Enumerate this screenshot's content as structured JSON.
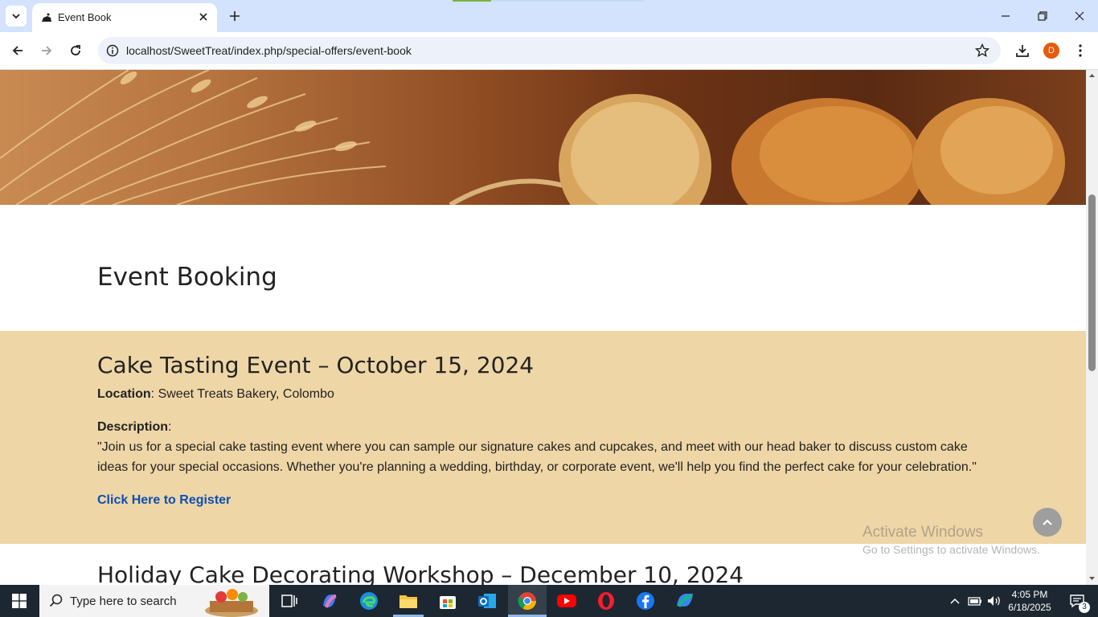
{
  "browser": {
    "tab_title": "Event Book",
    "url": "localhost/SweetTreat/index.php/special-offers/event-book",
    "profile_initial": "D"
  },
  "page": {
    "heading": "Event Booking",
    "event1": {
      "title": "Cake Tasting Event – October 15, 2024",
      "location_label": "Location",
      "location_value": ": Sweet Treats Bakery, Colombo",
      "description_label": "Description",
      "description_colon": ":",
      "description": "\"Join us for a special cake tasting event where you can sample our signature cakes and cupcakes, and meet with our head baker to discuss custom cake ideas for your special occasions. Whether you're planning a wedding, birthday, or corporate event, we'll help you find the perfect cake for your celebration.\"",
      "register_link": "Click Here to Register"
    },
    "event2": {
      "title": "Holiday Cake Decorating Workshop – December 10, 2024"
    }
  },
  "watermark": {
    "line1": "Activate Windows",
    "line2": "Go to Settings to activate Windows."
  },
  "taskbar": {
    "search_placeholder": "Type here to search",
    "time": "4:05 PM",
    "date": "6/18/2025",
    "notification_count": "3"
  },
  "colors": {
    "event_bg": "#efd6a6",
    "link": "#0b4fb3",
    "tabbar": "#d3e3fd"
  }
}
